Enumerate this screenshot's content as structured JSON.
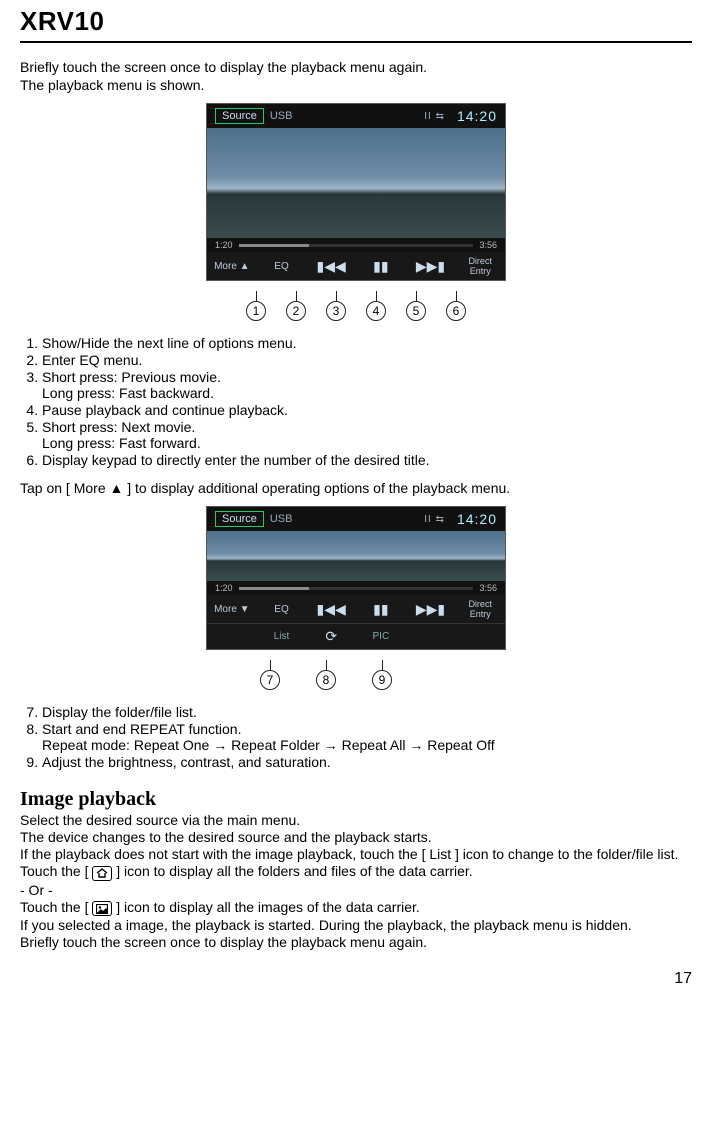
{
  "title": "XRV10",
  "intro_l1": "Briefly touch the screen once to display the playback menu again.",
  "intro_l2": "The playback menu is shown.",
  "screen": {
    "source_btn": "Source",
    "source_txt": "USB",
    "top_icons": "ΙΙ  ⇆",
    "clock": "14:20",
    "t_elapsed": "1:20",
    "t_total": "3:56",
    "more_up": "More ▲",
    "more_down": "More ▼",
    "eq": "EQ",
    "prev": "▮◀◀",
    "pause": "▮▮",
    "next": "▶▶▮",
    "direct_l1": "Direct",
    "direct_l2": "Entry",
    "list": "List",
    "repeat": "⟳",
    "pic": "PIC"
  },
  "callouts1": [
    "1",
    "2",
    "3",
    "4",
    "5",
    "6"
  ],
  "list1": {
    "i1": "Show/Hide the next line of options menu.",
    "i2": "Enter EQ menu.",
    "i3a": "Short press: Previous movie.",
    "i3b": "Long press: Fast backward.",
    "i4": "Pause playback and continue playback.",
    "i5a": "Short press: Next movie.",
    "i5b": "Long press: Fast forward.",
    "i6": "Display keypad to directly enter the number of the desired title."
  },
  "tap_more": "Tap on [ More ▲ ] to display additional operating options of the playback menu.",
  "callouts2": [
    "7",
    "8",
    "9"
  ],
  "list2": {
    "i7": "Display the folder/file list.",
    "i8a": "Start and end REPEAT function.",
    "i8b": "Repeat mode: Repeat One → Repeat Folder → Repeat All → Repeat Off",
    "i9": "Adjust the brightness, contrast, and saturation."
  },
  "heading2": "Image playback",
  "img": {
    "p1": "Select the desired source via the main menu.",
    "p2": "The device changes to the desired source and the playback starts.",
    "p3": "If the playback does not start with the image playback, touch the [ List ] icon to change to the folder/file list.",
    "p4a": "Touch the [",
    "p4b": "] icon to display all the folders and files of the data carrier.",
    "p5": "- Or -",
    "p6a": "Touch the [",
    "p6b": "] icon to display all the images of the data carrier.",
    "p7": "If you selected a image, the playback is started. During the playback, the playback menu is hidden.",
    "p8": "Briefly touch the screen once to display the playback menu again."
  },
  "page_number": "17"
}
